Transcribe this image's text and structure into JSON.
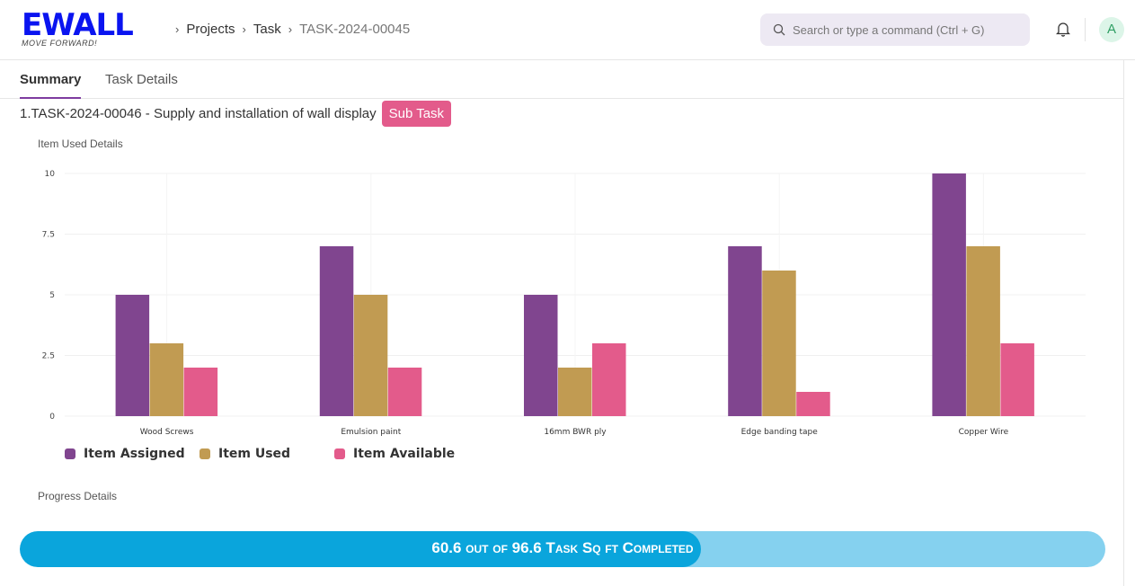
{
  "header": {
    "logo": "EWALL",
    "logo_tagline": "MOVE FORWARD!",
    "breadcrumbs": [
      "Projects",
      "Task",
      "TASK-2024-00045"
    ],
    "search_placeholder": "Search or type a command (Ctrl + G)",
    "avatar": "A"
  },
  "tabs": [
    {
      "label": "Summary",
      "active": true
    },
    {
      "label": "Task Details",
      "active": false
    }
  ],
  "task": {
    "title": "1.TASK-2024-00046 - Supply and installation of wall display",
    "badge": "Sub Task"
  },
  "sections": {
    "items": "Item Used Details",
    "progress": "Progress Details"
  },
  "chart_data": {
    "type": "bar",
    "categories": [
      "Wood Screws",
      "Emulsion paint",
      "16mm BWR ply",
      "Edge banding tape",
      "Copper Wire"
    ],
    "series": [
      {
        "name": "Item Assigned",
        "values": [
          5,
          7,
          5,
          7,
          10
        ],
        "color": "#80458f"
      },
      {
        "name": "Item Used",
        "values": [
          3,
          5,
          2,
          6,
          7
        ],
        "color": "#c19b52"
      },
      {
        "name": "Item Available",
        "values": [
          2,
          2,
          3,
          1,
          3
        ],
        "color": "#e35b8b"
      }
    ],
    "yticks": [
      "0",
      "2.5",
      "5",
      "7.5",
      "10"
    ],
    "ylim": [
      0,
      10
    ],
    "legend": "bottom-left",
    "grid": true
  },
  "progress": {
    "completed": 60.6,
    "total": 96.6,
    "text": "60.6 out of 96.6 Task Sq ft Completed"
  }
}
